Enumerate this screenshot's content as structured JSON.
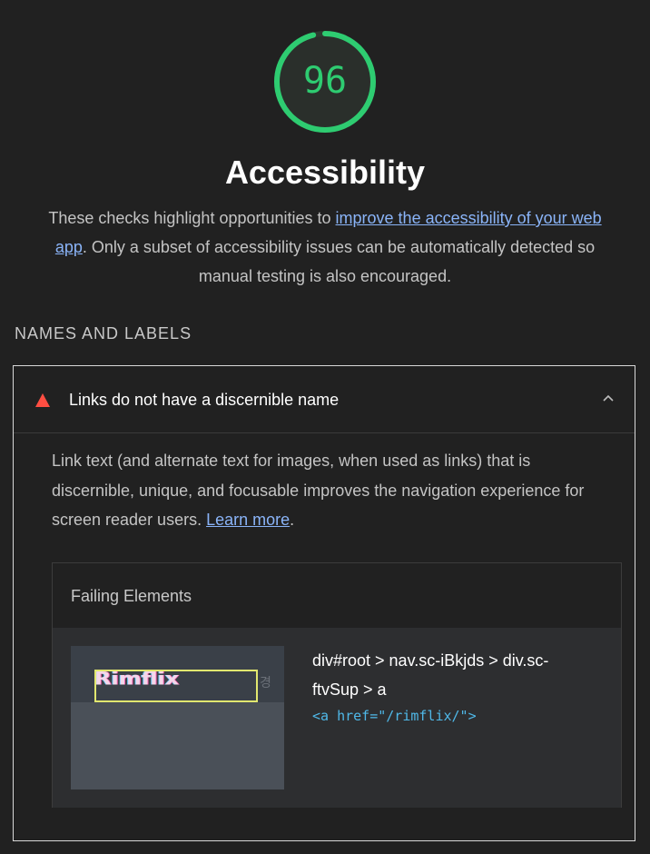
{
  "gauge": {
    "score": "96",
    "fraction": 0.96,
    "color": "#2ecc71"
  },
  "title": "Accessibility",
  "description": {
    "before": "These checks highlight opportunities to ",
    "link": "improve the accessibility of your web app",
    "after": ". Only a subset of accessibility issues can be automatically detected so manual testing is also encouraged."
  },
  "group": {
    "title": "NAMES AND LABELS"
  },
  "audit": {
    "status_icon": "warning-triangle-icon",
    "status_color": "#ff4e42",
    "title": "Links do not have a discernible name",
    "toggle_icon": "chevron-up-icon",
    "desc_before": "Link text (and alternate text for images, when used as links) that is discernible, unique, and focusable improves the navigation experience for screen reader users. ",
    "desc_link": "Learn more",
    "desc_after": ".",
    "failing": {
      "header": "Failing Elements",
      "items": [
        {
          "thumbnail_text": "Rimflix",
          "selector": "div#root > nav.sc-iBkjds > div.sc-ftvSup > a",
          "snippet": "<a href=\"/rimflix/\">"
        }
      ]
    }
  }
}
